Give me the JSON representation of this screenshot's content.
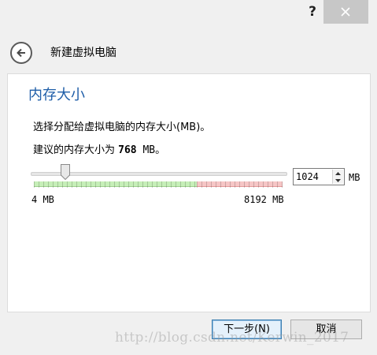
{
  "titlebar": {
    "help_label": "?",
    "close_icon": "close-icon"
  },
  "header": {
    "back_icon": "back-arrow-icon",
    "title": "新建虚拟电脑"
  },
  "page": {
    "title": "内存大小",
    "description": "选择分配给虚拟电脑的内存大小(MB)。",
    "recommend_prefix": "建议的内存大小为 ",
    "recommend_value": "768",
    "recommend_suffix": " MB。"
  },
  "memory": {
    "value": "1024",
    "unit": "MB",
    "min_label": "4 MB",
    "max_label": "8192 MB",
    "min": 4,
    "max": 8192,
    "current": 1024,
    "recommended": 768,
    "green_fraction": 0.655,
    "green_color": "#c6efb8",
    "red_color": "#f6c6c6"
  },
  "footer": {
    "next_label": "下一步(N)",
    "cancel_label": "取消"
  },
  "watermark": "http://blog.csdn.net/Kerwin_2017"
}
